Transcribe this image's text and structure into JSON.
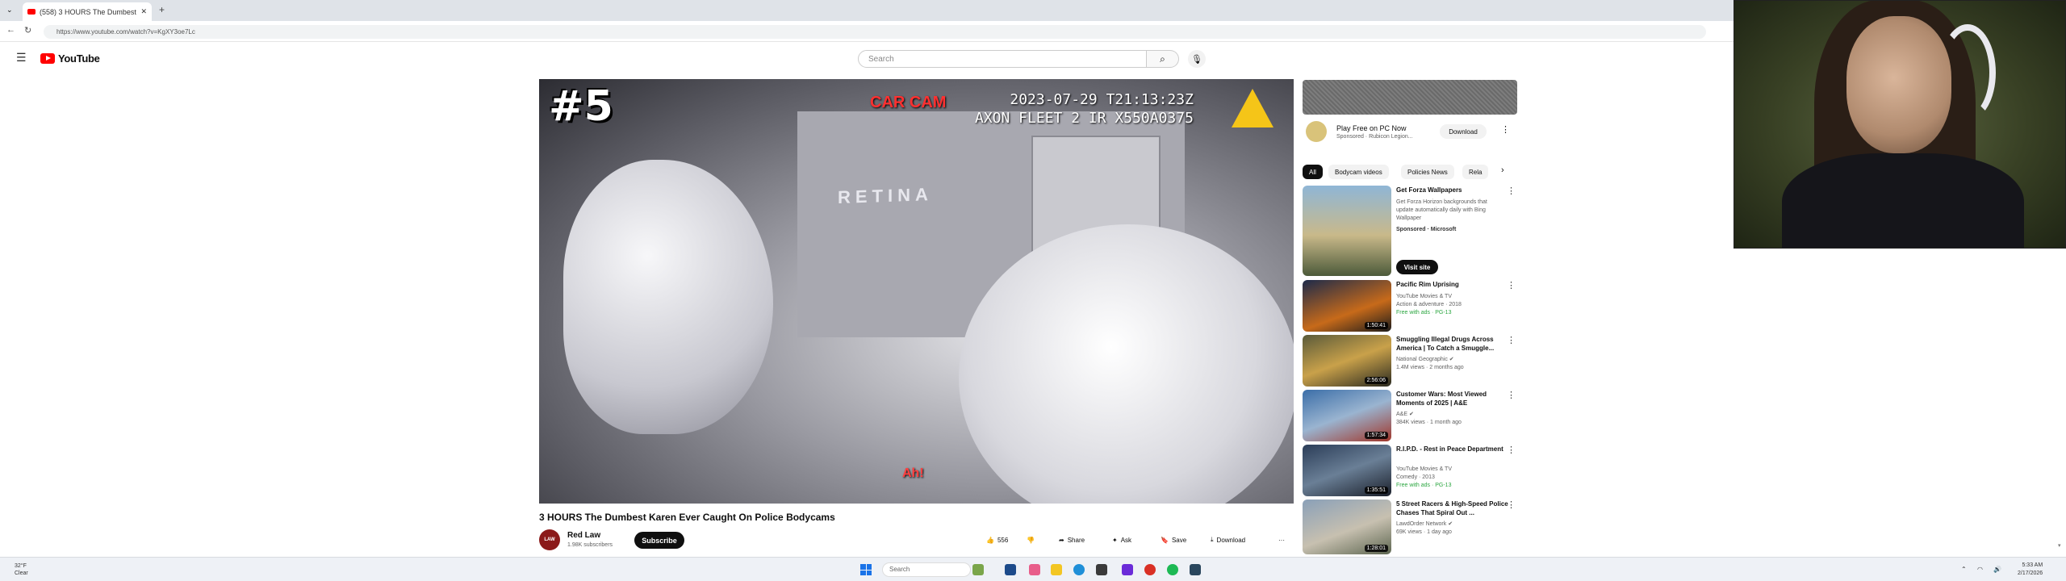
{
  "browser": {
    "tab_title": "(558) 3 HOURS The Dumbest",
    "new_tab": "+",
    "url": "https://www.youtube.com/watch?v=KgXY3oe7Lc"
  },
  "youtube": {
    "logo_text": "YouTube",
    "search_placeholder": "Search"
  },
  "video": {
    "overlay_number": "#5",
    "car_cam": "CAR CAM",
    "timestamp": "2023-07-29 T21:13:23Z",
    "device": "AXON FLEET 2 IR X550A0375",
    "interior_text": "RETINA",
    "subtitle": "Ah!",
    "title": "3 HOURS The Dumbest Karen Ever Caught On Police Bodycams",
    "channel_name": "Red Law",
    "channel_subs": "1.98K subscribers",
    "channel_avatar_text": "LAW",
    "subscribe_label": "Subscribe",
    "actions": {
      "like": "556",
      "share": "Share",
      "ask": "Ask",
      "save": "Save",
      "download": "Download",
      "more": "···"
    }
  },
  "sidebar": {
    "ad": {
      "title": "Play Free on PC Now",
      "sub": "Sponsored · Rubicon Legion...",
      "download": "Download"
    },
    "chips": [
      "All",
      "Bodycam videos",
      "Policies News",
      "Rela"
    ],
    "recs": [
      {
        "title": "Get Forza Wallpapers",
        "meta1": "Get Forza Horizon backgrounds that",
        "meta2": "update automatically daily with Bing",
        "meta3": "Wallpaper",
        "meta4": "Sponsored · Microsoft",
        "duration": "",
        "visit": "Visit site"
      },
      {
        "title": "Pacific Rim Uprising",
        "meta1": "YouTube Movies & TV",
        "meta2": "Action & adventure · 2018",
        "meta3": "Free with ads · PG-13",
        "duration": "1:50:41"
      },
      {
        "title": "Smuggling Illegal Drugs Across America | To Catch a Smuggle...",
        "meta1": "National Geographic ✔",
        "meta2": "1.4M views · 2 months ago",
        "meta3": "",
        "duration": "2:56:06"
      },
      {
        "title": "Customer Wars: Most Viewed Moments of 2025 | A&E",
        "meta1": "A&E ✔",
        "meta2": "384K views · 1 month ago",
        "meta3": "",
        "duration": "1:57:34"
      },
      {
        "title": "R.I.P.D. - Rest in Peace Department",
        "meta1": "YouTube Movies & TV",
        "meta2": "Comedy · 2013",
        "meta3": "Free with ads · PG-13",
        "duration": "1:35:51"
      },
      {
        "title": "5 Street Racers & High-Speed Police Chases That Spiral Out ...",
        "meta1": "LawdOrder Network ✔",
        "meta2": "69K views · 1 day ago",
        "meta3": "",
        "duration": "1:28:01"
      }
    ]
  },
  "taskbar": {
    "weather_temp": "32°F",
    "weather_desc": "Clear",
    "search": "Search",
    "time": "5:33 AM",
    "date": "2/17/2026"
  },
  "colors": {
    "yt_red": "#ff0000",
    "free_green": "#2ba640",
    "win_blue": "#1a73e8"
  }
}
